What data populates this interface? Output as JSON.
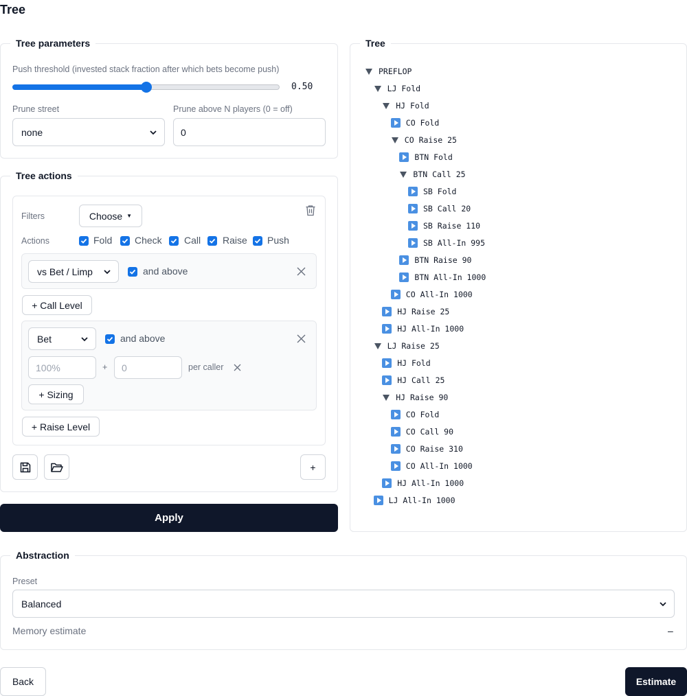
{
  "page_title": "Tree",
  "params": {
    "legend": "Tree parameters",
    "push_label": "Push threshold (invested stack fraction after which bets become push)",
    "push_value": "0.50",
    "push_fraction": 0.5,
    "prune_street_label": "Prune street",
    "prune_street_value": "none",
    "prune_players_label": "Prune above N players (0 = off)",
    "prune_players_value": "0"
  },
  "actions": {
    "legend": "Tree actions",
    "filters_label": "Filters",
    "filters_value": "Choose",
    "actions_label": "Actions",
    "checkboxes": [
      "Fold",
      "Check",
      "Call",
      "Raise",
      "Push"
    ],
    "call_level": {
      "select": "vs Bet / Limp",
      "and_above": "and above"
    },
    "add_call_level": "+ Call Level",
    "raise_level": {
      "select": "Bet",
      "and_above": "and above",
      "size_placeholder": "100%",
      "plus": "+",
      "per_caller_placeholder": "0",
      "per_caller_label": "per caller"
    },
    "add_sizing": "+ Sizing",
    "add_raise_level": "+ Raise Level",
    "add_button": "+",
    "icons": [
      "save-icon",
      "folder-open-icon",
      "trash-icon",
      "close-icon"
    ]
  },
  "apply_label": "Apply",
  "tree": {
    "legend": "Tree",
    "nodes": [
      {
        "label": "PREFLOP",
        "expanded": true
      },
      {
        "label": "LJ Fold",
        "expanded": true
      },
      {
        "label": "HJ Fold",
        "expanded": true
      },
      {
        "label": "CO Fold",
        "expanded": false
      },
      {
        "label": "CO Raise 25",
        "expanded": true
      },
      {
        "label": "BTN Fold",
        "expanded": false
      },
      {
        "label": "BTN Call 25",
        "expanded": true
      },
      {
        "label": "SB Fold",
        "expanded": false
      },
      {
        "label": "SB Call 20",
        "expanded": false
      },
      {
        "label": "SB Raise 110",
        "expanded": false
      },
      {
        "label": "SB All-In 995",
        "expanded": false
      },
      {
        "label": "BTN Raise 90",
        "expanded": false
      },
      {
        "label": "BTN All-In 1000",
        "expanded": false
      },
      {
        "label": "CO All-In 1000",
        "expanded": false
      },
      {
        "label": "HJ Raise 25",
        "expanded": false
      },
      {
        "label": "HJ All-In 1000",
        "expanded": false
      },
      {
        "label": "LJ Raise 25",
        "expanded": true
      },
      {
        "label": "HJ Fold",
        "expanded": false
      },
      {
        "label": "HJ Call 25",
        "expanded": false
      },
      {
        "label": "HJ Raise 90",
        "expanded": true
      },
      {
        "label": "CO Fold",
        "expanded": false
      },
      {
        "label": "CO Call 90",
        "expanded": false
      },
      {
        "label": "CO Raise 310",
        "expanded": false
      },
      {
        "label": "CO All-In 1000",
        "expanded": false
      },
      {
        "label": "HJ All-In 1000",
        "expanded": false
      },
      {
        "label": "LJ All-In 1000",
        "expanded": false
      }
    ]
  },
  "abstraction": {
    "legend": "Abstraction",
    "preset_label": "Preset",
    "preset_value": "Balanced",
    "memory_label": "Memory estimate",
    "memory_value": "–"
  },
  "footer": {
    "back": "Back",
    "estimate": "Estimate"
  },
  "colors": {
    "accent": "#1473e6",
    "dark_button": "#0f172a",
    "tree_icon": "#4a90e2"
  }
}
